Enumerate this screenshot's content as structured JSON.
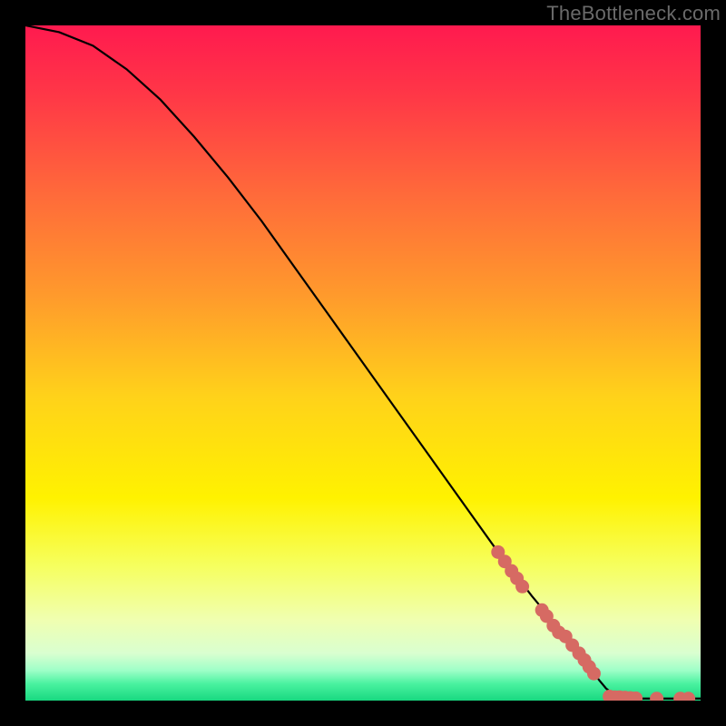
{
  "watermark": "TheBottleneck.com",
  "chart_data": {
    "type": "line",
    "title": "",
    "xlabel": "",
    "ylabel": "",
    "xlim": [
      0,
      100
    ],
    "ylim": [
      0,
      100
    ],
    "curve": [
      {
        "x": 0,
        "y": 100
      },
      {
        "x": 5,
        "y": 99
      },
      {
        "x": 10,
        "y": 97
      },
      {
        "x": 15,
        "y": 93.5
      },
      {
        "x": 20,
        "y": 89
      },
      {
        "x": 25,
        "y": 83.5
      },
      {
        "x": 30,
        "y": 77.5
      },
      {
        "x": 35,
        "y": 71
      },
      {
        "x": 40,
        "y": 64
      },
      {
        "x": 45,
        "y": 57
      },
      {
        "x": 50,
        "y": 50
      },
      {
        "x": 55,
        "y": 43
      },
      {
        "x": 60,
        "y": 36
      },
      {
        "x": 65,
        "y": 29
      },
      {
        "x": 70,
        "y": 22
      },
      {
        "x": 75,
        "y": 15.5
      },
      {
        "x": 80,
        "y": 9.5
      },
      {
        "x": 82,
        "y": 7
      },
      {
        "x": 83.5,
        "y": 5
      },
      {
        "x": 85,
        "y": 3
      },
      {
        "x": 86,
        "y": 1.8
      },
      {
        "x": 87,
        "y": 1.0
      },
      {
        "x": 88,
        "y": 0.5
      },
      {
        "x": 90,
        "y": 0.3
      },
      {
        "x": 95,
        "y": 0.3
      },
      {
        "x": 100,
        "y": 0.3
      }
    ],
    "markers_on_curve": [
      {
        "x": 70,
        "y": 22
      },
      {
        "x": 71,
        "y": 20.6
      },
      {
        "x": 72,
        "y": 19.2
      },
      {
        "x": 72.8,
        "y": 18.1
      },
      {
        "x": 73.6,
        "y": 16.9
      },
      {
        "x": 76.5,
        "y": 13.4
      },
      {
        "x": 77.2,
        "y": 12.5
      },
      {
        "x": 78.2,
        "y": 11.1
      },
      {
        "x": 79,
        "y": 10.1
      },
      {
        "x": 80,
        "y": 9.5
      },
      {
        "x": 81,
        "y": 8.2
      },
      {
        "x": 82,
        "y": 7.0
      },
      {
        "x": 82.8,
        "y": 6.0
      },
      {
        "x": 83.5,
        "y": 5.0
      },
      {
        "x": 84.2,
        "y": 4.0
      }
    ],
    "markers_bottom": [
      {
        "x": 86.5,
        "y": 0.6
      },
      {
        "x": 87.3,
        "y": 0.5
      },
      {
        "x": 88.0,
        "y": 0.5
      },
      {
        "x": 88.8,
        "y": 0.45
      },
      {
        "x": 89.6,
        "y": 0.4
      },
      {
        "x": 90.4,
        "y": 0.35
      },
      {
        "x": 93.5,
        "y": 0.3
      },
      {
        "x": 97.0,
        "y": 0.3
      },
      {
        "x": 98.2,
        "y": 0.3
      }
    ],
    "gradient_stops": [
      {
        "offset": 0.0,
        "color": "#ff1a4f"
      },
      {
        "offset": 0.1,
        "color": "#ff3647"
      },
      {
        "offset": 0.25,
        "color": "#ff6a3a"
      },
      {
        "offset": 0.4,
        "color": "#ff9a2c"
      },
      {
        "offset": 0.55,
        "color": "#ffd21a"
      },
      {
        "offset": 0.7,
        "color": "#fff200"
      },
      {
        "offset": 0.8,
        "color": "#f6ff5e"
      },
      {
        "offset": 0.88,
        "color": "#f0ffb0"
      },
      {
        "offset": 0.93,
        "color": "#d9ffd0"
      },
      {
        "offset": 0.955,
        "color": "#9fffc8"
      },
      {
        "offset": 0.975,
        "color": "#4af2a0"
      },
      {
        "offset": 1.0,
        "color": "#18d880"
      }
    ],
    "marker_color": "#d66a63",
    "curve_color": "#000000"
  }
}
